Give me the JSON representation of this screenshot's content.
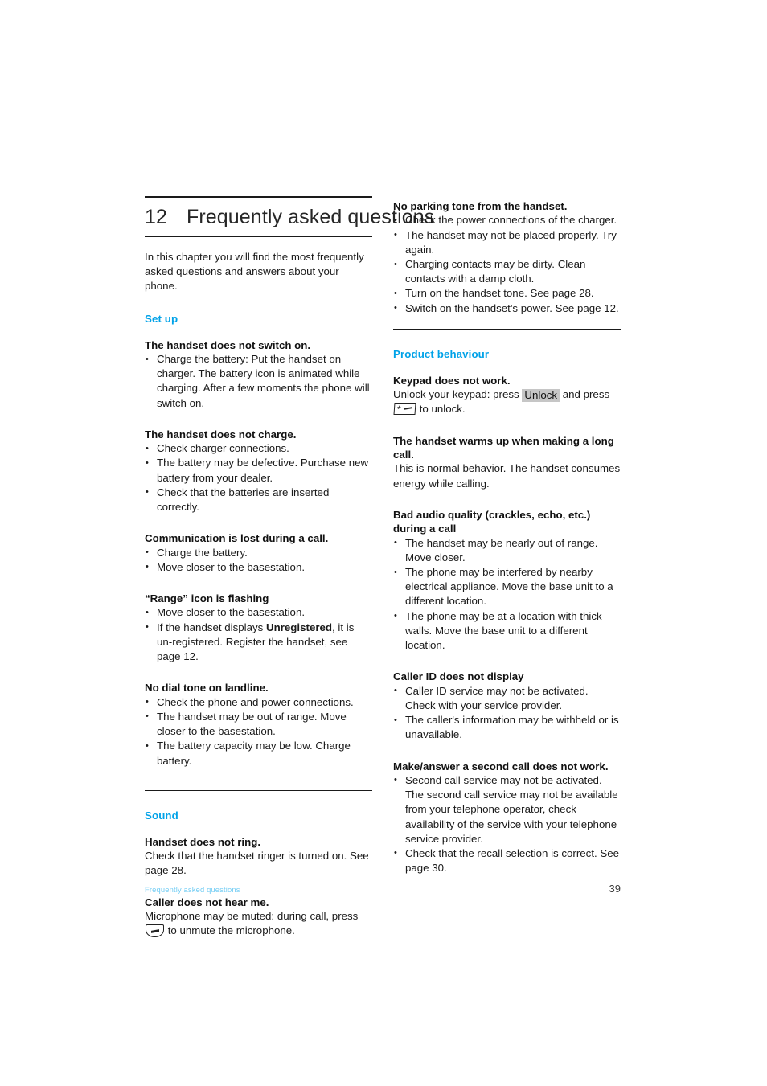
{
  "chapter": {
    "number": "12",
    "title": "Frequently asked questions",
    "intro": "In this chapter you will find the most frequently asked questions and answers about your phone."
  },
  "left_column": {
    "sections": [
      {
        "heading": "Set up",
        "entries": [
          {
            "question": "The handset does not switch on.",
            "bullets": [
              "Charge the battery: Put the handset on charger. The battery icon is animated while charging. After a few moments the phone will switch on."
            ]
          },
          {
            "question": "The handset does not charge.",
            "bullets": [
              "Check charger connections.",
              "The battery may be defective. Purchase new battery from your dealer.",
              "Check that the batteries are inserted correctly."
            ]
          },
          {
            "question": "Communication is lost during a call.",
            "bullets": [
              "Charge the battery.",
              "Move closer to the basestation."
            ]
          },
          {
            "question": "“Range” icon is flashing",
            "bullets_rich": [
              {
                "text_before": "Move closer to the basestation.",
                "bold": "",
                "text_after": ""
              },
              {
                "text_before": "If the handset displays ",
                "bold": "Unregistered",
                "text_after": ", it is un-registered. Register the handset, see page 12."
              }
            ]
          },
          {
            "question": "No dial tone on landline.",
            "bullets": [
              "Check the phone and power connections.",
              "The handset may be out of range. Move closer to the basestation.",
              "The battery capacity may be low. Charge battery."
            ]
          }
        ]
      },
      {
        "heading": "Sound",
        "entries": [
          {
            "question": "Handset does not ring.",
            "answer": "Check that the handset ringer is turned on. See page 28."
          },
          {
            "question": "Caller does not hear me.",
            "answer_before_key": "Microphone may be muted: during call, press ",
            "mute_key_icon": "mute-key-icon",
            "answer_after_key": " to unmute the microphone."
          }
        ]
      }
    ]
  },
  "right_column": {
    "top_entry": {
      "question": "No parking tone from the handset.",
      "bullets": [
        "Check the power connections of the charger.",
        "The handset may not be placed properly. Try again.",
        "Charging contacts may be dirty. Clean contacts with a damp cloth.",
        "Turn on the handset tone. See page 28.",
        "Switch on the handset's power. See page 12."
      ]
    },
    "sections": [
      {
        "heading": "Product behaviour",
        "entries": [
          {
            "question": "Keypad does not work.",
            "answer_part1": "Unlock your keypad: press ",
            "softkey_label": "Unlock",
            "answer_part2": " and press ",
            "star_key_icon": "star-key-icon",
            "answer_part3": " to unlock."
          },
          {
            "question": "The handset warms up when making a long call.",
            "answer": "This is normal behavior. The handset consumes energy while calling."
          },
          {
            "question": "Bad audio quality (crackles, echo, etc.) during a call",
            "bullets": [
              "The handset may be nearly out of range. Move closer.",
              "The phone may be interfered by nearby electrical appliance. Move the base unit to a different location.",
              "The phone may be at a location with thick walls. Move the base unit to a different location."
            ]
          },
          {
            "question": "Caller ID does not display",
            "bullets": [
              "Caller ID service may not be activated. Check with your service provider.",
              "The caller's information may be withheld or is unavailable."
            ]
          },
          {
            "question": "Make/answer a second call does not work.",
            "bullets": [
              "Second call service may not be activated. The second call service may not be available from your telephone operator, check availability of the service with your telephone service provider.",
              "Check that the recall selection is correct. See page 30."
            ]
          }
        ]
      }
    ]
  },
  "footer": {
    "left": "Frequently asked questions",
    "page_number": "39"
  },
  "colors": {
    "section_heading": "#00A2E8",
    "footer_left": "#73CDF4",
    "softkey_background": "#c6c6c6",
    "body_text": "#1a1a1a"
  }
}
